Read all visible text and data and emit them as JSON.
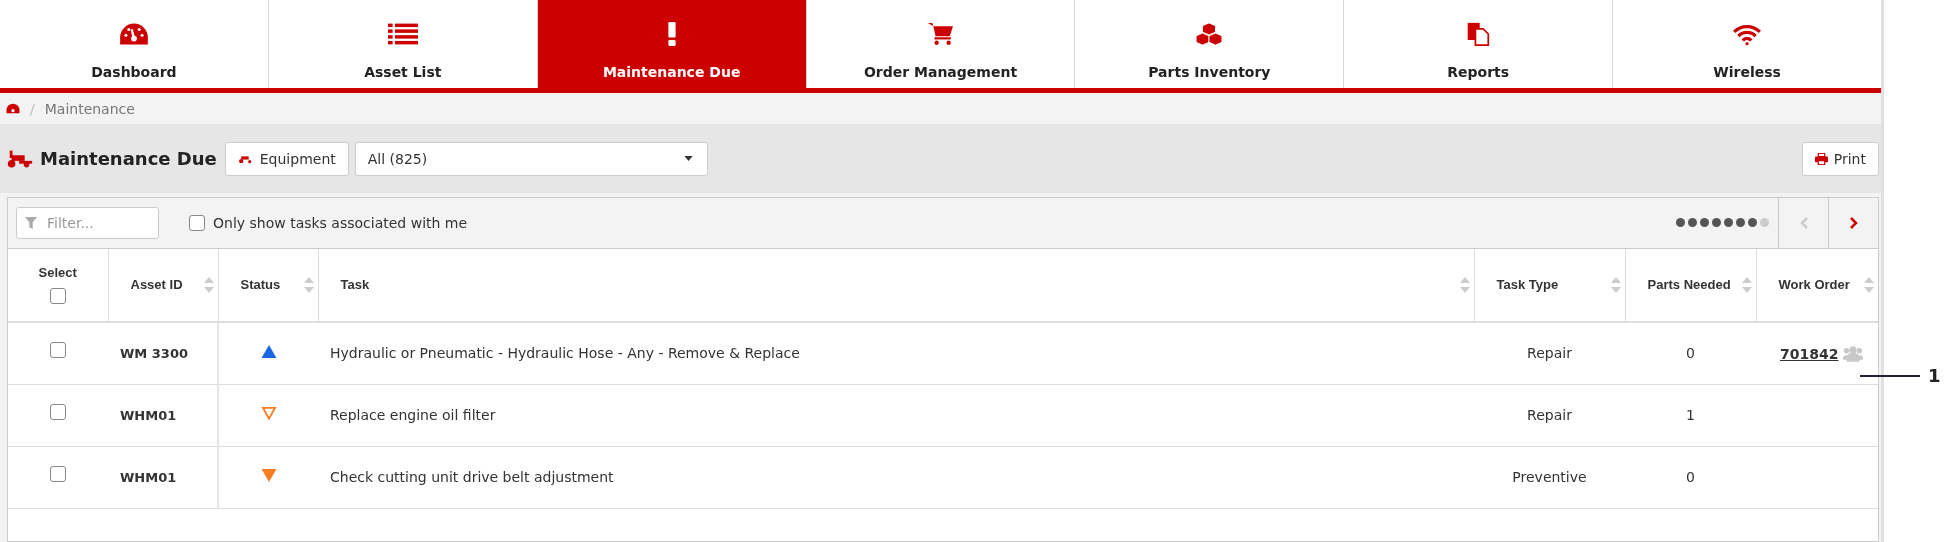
{
  "nav": [
    {
      "label": "Dashboard",
      "selected": false
    },
    {
      "label": "Asset List",
      "selected": false
    },
    {
      "label": "Maintenance Due",
      "selected": true
    },
    {
      "label": "Order Management",
      "selected": false
    },
    {
      "label": "Parts Inventory",
      "selected": false
    },
    {
      "label": "Reports",
      "selected": false
    },
    {
      "label": "Wireless",
      "selected": false
    }
  ],
  "breadcrumb": {
    "separator": "/",
    "current": "Maintenance"
  },
  "header": {
    "title": "Maintenance Due",
    "equipment_button": "Equipment",
    "filter_select": "All (825)",
    "print_button": "Print"
  },
  "toolbar": {
    "filter_placeholder": "Filter...",
    "only_mine": {
      "label": "Only show tasks associated with me",
      "checked": false
    },
    "page_dots": [
      {
        "selected": false
      },
      {
        "selected": false
      },
      {
        "selected": false
      },
      {
        "selected": false
      },
      {
        "selected": false
      },
      {
        "selected": false
      },
      {
        "selected": false
      },
      {
        "selected": true
      }
    ]
  },
  "table": {
    "select_all_label": "Select",
    "select_all_checked": false,
    "columns": [
      {
        "label": "Asset ID"
      },
      {
        "label": "Status"
      },
      {
        "label": "Task"
      },
      {
        "label": "Task Type"
      },
      {
        "label": "Parts Needed"
      },
      {
        "label": "Work Order"
      }
    ],
    "rows": [
      {
        "checked": false,
        "asset_id": "WM 3300",
        "status": {
          "kind": "up",
          "color": "#1a66e0"
        },
        "task": "Hydraulic or Pneumatic - Hydraulic Hose - Any - Remove & Replace",
        "task_type": "Repair",
        "parts_needed": "0",
        "work_order": "701842",
        "team": true
      },
      {
        "checked": false,
        "asset_id": "WHM01",
        "status": {
          "kind": "down-outline",
          "color": "#fb7d22"
        },
        "task": "Replace engine oil filter",
        "task_type": "Repair",
        "parts_needed": "1",
        "team": false
      },
      {
        "checked": false,
        "asset_id": "WHM01",
        "status": {
          "kind": "down",
          "color": "#fb7d22"
        },
        "task": "Check cutting unit drive belt adjustment",
        "task_type": "Preventive",
        "parts_needed": "0",
        "team": false
      }
    ]
  },
  "callout": {
    "label": "1"
  }
}
